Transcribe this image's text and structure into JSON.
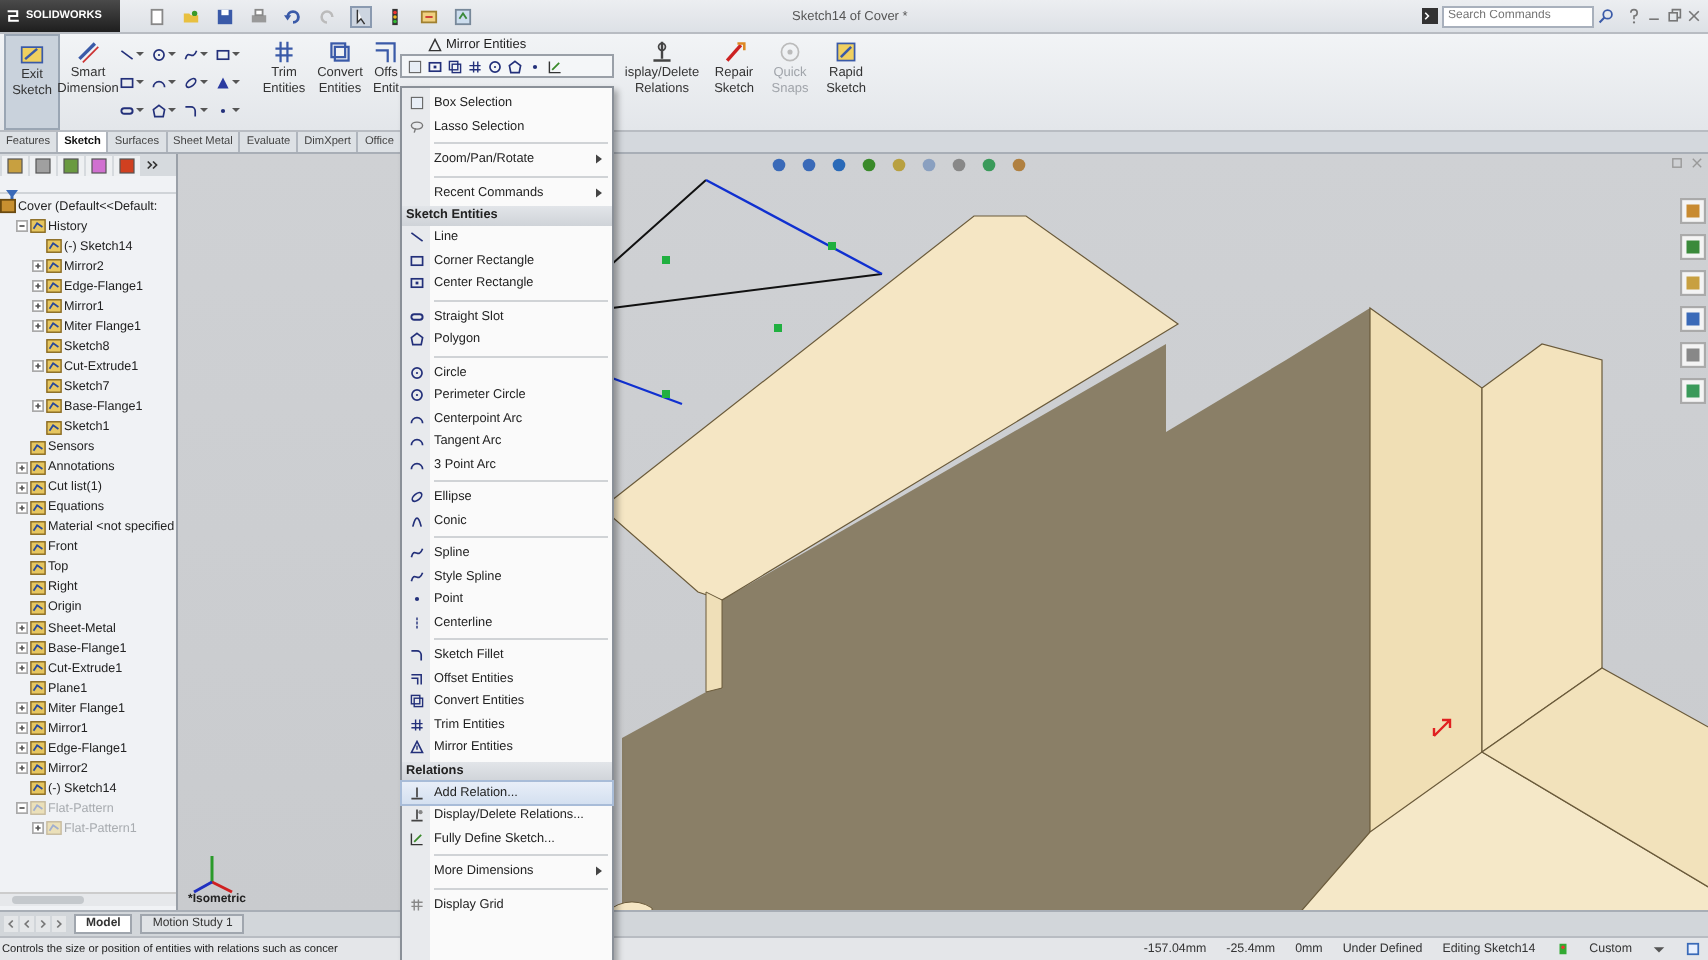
{
  "app": {
    "logo": "SOLIDWORKS",
    "title": "Sketch14 of Cover *"
  },
  "search": {
    "placeholder": "Search Commands"
  },
  "ribbon": {
    "left": [
      {
        "label": "Exit Sketch",
        "pressed": true
      },
      {
        "label": "Smart Dimension",
        "pressed": false
      }
    ],
    "middle": [
      {
        "label": "Trim Entities"
      },
      {
        "label": "Convert Entities"
      },
      {
        "label": "Offs Entit"
      }
    ],
    "mirror": "Mirror Entities",
    "right": [
      {
        "label": "isplay/Delete Relations",
        "disabled": false
      },
      {
        "label": "Repair Sketch",
        "disabled": false
      },
      {
        "label": "Quick Snaps",
        "disabled": true
      },
      {
        "label": "Rapid Sketch",
        "disabled": false
      }
    ]
  },
  "tabs": [
    {
      "label": "Features",
      "selected": false
    },
    {
      "label": "Sketch",
      "selected": true
    },
    {
      "label": "Surfaces",
      "selected": false
    },
    {
      "label": "Sheet Metal",
      "selected": false
    },
    {
      "label": "Evaluate",
      "selected": false
    },
    {
      "label": "DimXpert",
      "selected": false
    },
    {
      "label": "Office",
      "selected": false
    }
  ],
  "tree": {
    "label": "Cover  (Default<<Default:",
    "children": [
      {
        "label": "History",
        "kind": "expanded",
        "disabled": false,
        "children": [
          {
            "label": "(-) Sketch14",
            "kind": "leaf",
            "disabled": false
          },
          {
            "label": "Mirror2",
            "kind": "collapsed",
            "disabled": false
          },
          {
            "label": "Edge-Flange1",
            "kind": "collapsed",
            "disabled": false
          },
          {
            "label": "Mirror1",
            "kind": "collapsed",
            "disabled": false
          },
          {
            "label": "Miter Flange1",
            "kind": "collapsed",
            "disabled": false
          },
          {
            "label": "Sketch8",
            "kind": "leaf",
            "disabled": false
          },
          {
            "label": "Cut-Extrude1",
            "kind": "collapsed",
            "disabled": false
          },
          {
            "label": "Sketch7",
            "kind": "leaf",
            "disabled": false
          },
          {
            "label": "Base-Flange1",
            "kind": "collapsed",
            "disabled": false
          },
          {
            "label": "Sketch1",
            "kind": "leaf",
            "disabled": false
          }
        ]
      },
      {
        "label": "Sensors",
        "kind": "leaf",
        "disabled": false
      },
      {
        "label": "Annotations",
        "kind": "collapsed",
        "disabled": false
      },
      {
        "label": "Cut list(1)",
        "kind": "collapsed",
        "disabled": false
      },
      {
        "label": "Equations",
        "kind": "collapsed",
        "disabled": false
      },
      {
        "label": "Material <not specified",
        "kind": "leaf",
        "disabled": false
      },
      {
        "label": "Front",
        "kind": "leaf",
        "disabled": false
      },
      {
        "label": "Top",
        "kind": "leaf",
        "disabled": false
      },
      {
        "label": "Right",
        "kind": "leaf",
        "disabled": false
      },
      {
        "label": "Origin",
        "kind": "leaf",
        "disabled": false
      },
      {
        "label": "Sheet-Metal",
        "kind": "collapsed",
        "disabled": false
      },
      {
        "label": "Base-Flange1",
        "kind": "collapsed",
        "disabled": false
      },
      {
        "label": "Cut-Extrude1",
        "kind": "collapsed",
        "disabled": false
      },
      {
        "label": "Plane1",
        "kind": "leaf",
        "disabled": false
      },
      {
        "label": "Miter Flange1",
        "kind": "collapsed",
        "disabled": false
      },
      {
        "label": "Mirror1",
        "kind": "collapsed",
        "disabled": false
      },
      {
        "label": "Edge-Flange1",
        "kind": "collapsed",
        "disabled": false
      },
      {
        "label": "Mirror2",
        "kind": "collapsed",
        "disabled": false
      },
      {
        "label": "(-) Sketch14",
        "kind": "leaf",
        "disabled": false
      },
      {
        "label": "Flat-Pattern",
        "kind": "expanded",
        "disabled": true,
        "children": [
          {
            "label": "Flat-Pattern1",
            "kind": "collapsed",
            "disabled": true
          }
        ]
      }
    ]
  },
  "viewport": {
    "view_label": "*Isometric"
  },
  "menu": {
    "sections": [
      {
        "items": [
          {
            "label": "Box Selection",
            "submenu": false,
            "highlighted": false
          },
          {
            "label": "Lasso Selection",
            "submenu": false,
            "highlighted": false
          }
        ]
      },
      {
        "items": [
          {
            "label": "Zoom/Pan/Rotate",
            "submenu": true,
            "highlighted": false
          }
        ]
      },
      {
        "items": [
          {
            "label": "Recent Commands",
            "submenu": true,
            "highlighted": false
          }
        ]
      },
      {
        "header": "Sketch Entities",
        "items": [
          {
            "label": "Line",
            "submenu": false,
            "highlighted": false
          },
          {
            "label": "Corner Rectangle",
            "submenu": false,
            "highlighted": false
          },
          {
            "label": "Center Rectangle",
            "submenu": false,
            "highlighted": false
          }
        ]
      },
      {
        "items": [
          {
            "label": "Straight Slot",
            "submenu": false,
            "highlighted": false
          },
          {
            "label": "Polygon",
            "submenu": false,
            "highlighted": false
          }
        ]
      },
      {
        "items": [
          {
            "label": "Circle",
            "submenu": false,
            "highlighted": false
          },
          {
            "label": "Perimeter Circle",
            "submenu": false,
            "highlighted": false
          },
          {
            "label": "Centerpoint Arc",
            "submenu": false,
            "highlighted": false
          },
          {
            "label": "Tangent Arc",
            "submenu": false,
            "highlighted": false
          },
          {
            "label": "3 Point Arc",
            "submenu": false,
            "highlighted": false
          }
        ]
      },
      {
        "items": [
          {
            "label": "Ellipse",
            "submenu": false,
            "highlighted": false
          },
          {
            "label": "Conic",
            "submenu": false,
            "highlighted": false
          }
        ]
      },
      {
        "items": [
          {
            "label": "Spline",
            "submenu": false,
            "highlighted": false
          },
          {
            "label": "Style Spline",
            "submenu": false,
            "highlighted": false
          },
          {
            "label": "Point",
            "submenu": false,
            "highlighted": false
          },
          {
            "label": "Centerline",
            "submenu": false,
            "highlighted": false
          }
        ]
      },
      {
        "items": [
          {
            "label": "Sketch Fillet",
            "submenu": false,
            "highlighted": false
          },
          {
            "label": "Offset Entities",
            "submenu": false,
            "highlighted": false
          },
          {
            "label": "Convert Entities",
            "submenu": false,
            "highlighted": false
          },
          {
            "label": "Trim Entities",
            "submenu": false,
            "highlighted": false
          },
          {
            "label": "Mirror Entities",
            "submenu": false,
            "highlighted": false
          }
        ]
      },
      {
        "header": "Relations",
        "items": [
          {
            "label": "Add Relation...",
            "submenu": false,
            "highlighted": true
          },
          {
            "label": "Display/Delete Relations...",
            "submenu": false,
            "highlighted": false
          },
          {
            "label": "Fully Define Sketch...",
            "submenu": false,
            "highlighted": false
          }
        ]
      },
      {
        "items": [
          {
            "label": "More Dimensions",
            "submenu": true,
            "highlighted": false
          }
        ]
      },
      {
        "items": [
          {
            "label": "Display Grid",
            "submenu": false,
            "highlighted": false
          }
        ]
      }
    ]
  },
  "bottom_tabs": [
    {
      "label": "Model",
      "selected": true
    },
    {
      "label": "Motion Study 1",
      "selected": false
    }
  ],
  "status_bar": {
    "hint": "Controls the size or position of entities with relations such as concer",
    "x": "-157.04mm",
    "y": "-25.4mm",
    "z": "0mm",
    "state": "Under Defined",
    "editing": "Editing Sketch14",
    "units": "Custom"
  }
}
